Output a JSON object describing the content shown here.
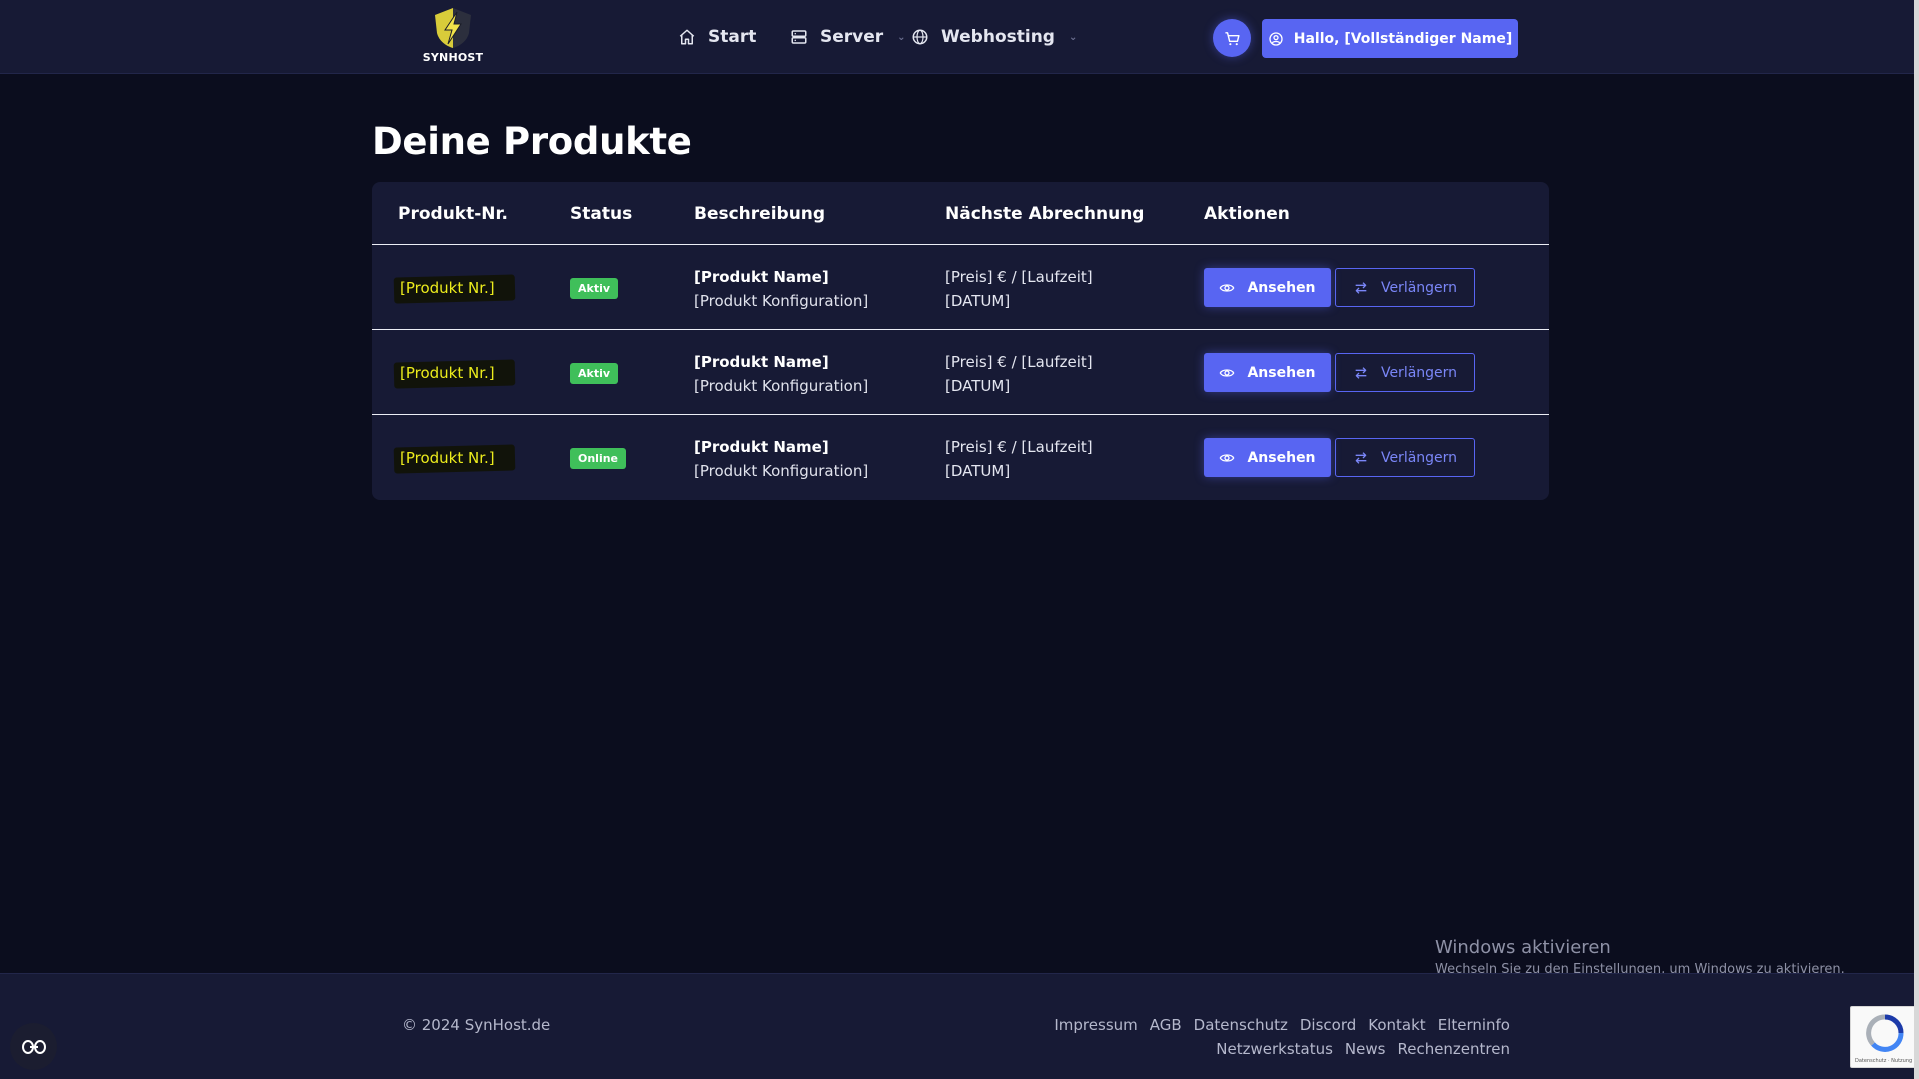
{
  "brand": {
    "logo_text": "SYNHOST",
    "accent_color": "#5865f2",
    "logo_color": "#e6d84a"
  },
  "nav": {
    "items": [
      {
        "label": "Start",
        "icon": "home-icon",
        "has_dropdown": false
      },
      {
        "label": "Server",
        "icon": "server-icon",
        "has_dropdown": true
      },
      {
        "label": "Webhosting",
        "icon": "globe-icon",
        "has_dropdown": true
      }
    ],
    "cart_icon": "cart-icon",
    "user_button_label": "Hallo, [Vollständiger Name]",
    "user_icon": "user-icon"
  },
  "page": {
    "title": "Deine Produkte"
  },
  "table": {
    "headers": [
      "Produkt-Nr.",
      "Status",
      "Beschreibung",
      "Nächste Abrechnung",
      "Aktionen"
    ],
    "rows": [
      {
        "product_nr": "[Produkt Nr.]",
        "status": "Aktiv",
        "name": "[Produkt Name]",
        "config": "[Produkt Konfiguration]",
        "price": "[Preis] € / [Laufzeit]",
        "date": "[DATUM]",
        "view_label": "Ansehen",
        "renew_label": "Verlängern"
      },
      {
        "product_nr": "[Produkt Nr.]",
        "status": "Aktiv",
        "name": "[Produkt Name]",
        "config": "[Produkt Konfiguration]",
        "price": "[Preis] € / [Laufzeit]",
        "date": "[DATUM]",
        "view_label": "Ansehen",
        "renew_label": "Verlängern"
      },
      {
        "product_nr": "[Produkt Nr.]",
        "status": "Online",
        "name": "[Produkt Name]",
        "config": "[Produkt Konfiguration]",
        "price": "[Preis] € / [Laufzeit]",
        "date": "[DATUM]",
        "view_label": "Ansehen",
        "renew_label": "Verlängern"
      }
    ],
    "status_color": "#3fbf5a"
  },
  "footer": {
    "copyright": "© 2024 SynHost.de",
    "links_row1": [
      "Impressum",
      "AGB",
      "Datenschutz",
      "Discord",
      "Kontakt",
      "Elterninfo"
    ],
    "links_row2": [
      "Netzwerkstatus",
      "News",
      "Rechenzentren"
    ]
  },
  "watermark": {
    "title": "Windows aktivieren",
    "subtitle": "Wechseln Sie zu den Einstellungen, um Windows zu aktivieren."
  }
}
